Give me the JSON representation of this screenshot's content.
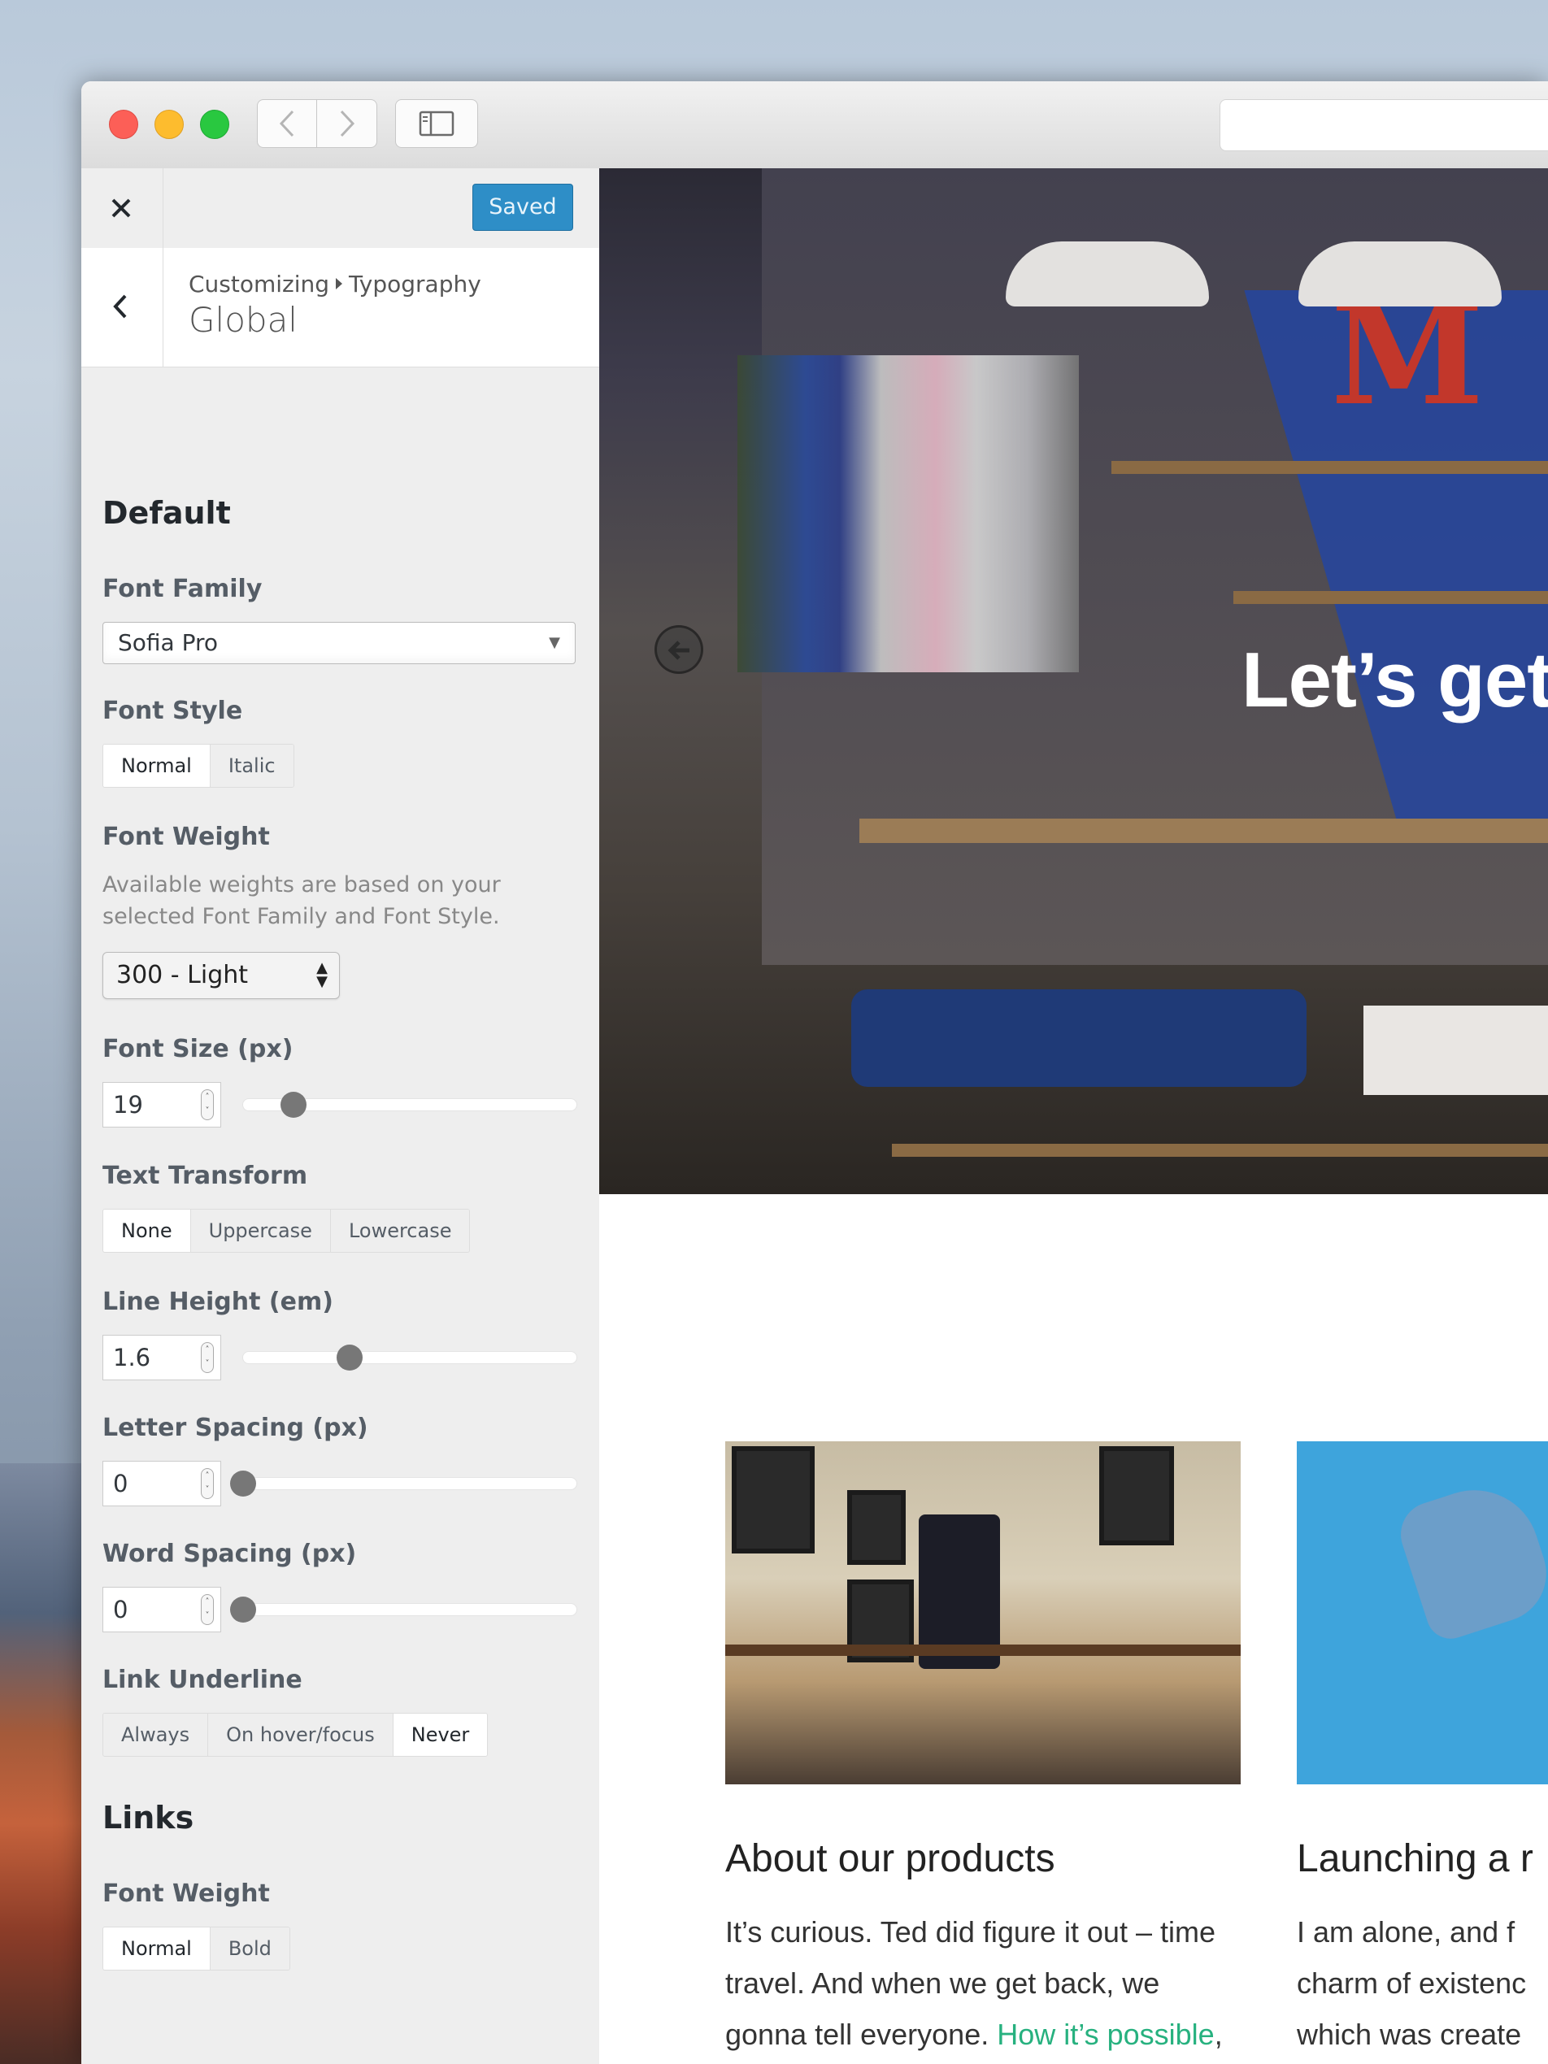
{
  "browser": {
    "traffic_lights": [
      "close",
      "minimize",
      "zoom"
    ]
  },
  "customizer": {
    "saved_label": "Saved",
    "breadcrumb": {
      "root": "Customizing",
      "section": "Typography"
    },
    "panel_title": "Global",
    "default": {
      "heading": "Default",
      "font_family": {
        "label": "Font Family",
        "value": "Sofia Pro"
      },
      "font_style": {
        "label": "Font Style",
        "options": [
          "Normal",
          "Italic"
        ],
        "selected": "Normal"
      },
      "font_weight": {
        "label": "Font Weight",
        "description": "Available weights are based on your selected Font Family and Font Style.",
        "value": "300 - Light"
      },
      "font_size": {
        "label": "Font Size (px)",
        "value": "19",
        "slider_fraction": 0.15
      },
      "text_transform": {
        "label": "Text Transform",
        "options": [
          "None",
          "Uppercase",
          "Lowercase"
        ],
        "selected": "None"
      },
      "line_height": {
        "label": "Line Height (em)",
        "value": "1.6",
        "slider_fraction": 0.32
      },
      "letter_spacing": {
        "label": "Letter Spacing (px)",
        "value": "0",
        "slider_fraction": 0.0
      },
      "word_spacing": {
        "label": "Word Spacing (px)",
        "value": "0",
        "slider_fraction": 0.0
      },
      "link_underline": {
        "label": "Link Underline",
        "options": [
          "Always",
          "On hover/focus",
          "Never"
        ],
        "selected": "Never"
      }
    },
    "links": {
      "heading": "Links",
      "font_weight": {
        "label": "Font Weight",
        "options": [
          "Normal",
          "Bold"
        ],
        "selected": "Normal"
      }
    }
  },
  "preview": {
    "hero_text": "Let’s get",
    "cards": [
      {
        "title": "About our products",
        "body_before_link": "It’s curious. Ted did figure it out – time travel. And when we get back, we gonna tell everyone.",
        "link_text": "How it’s possible",
        "body_after_link": ", how it’s done, what the dangers are. But then"
      },
      {
        "title": "Launching a r",
        "body": "I am alone, and f charm of existenc which was create souls like mine. I a my dear friend, s"
      }
    ]
  }
}
